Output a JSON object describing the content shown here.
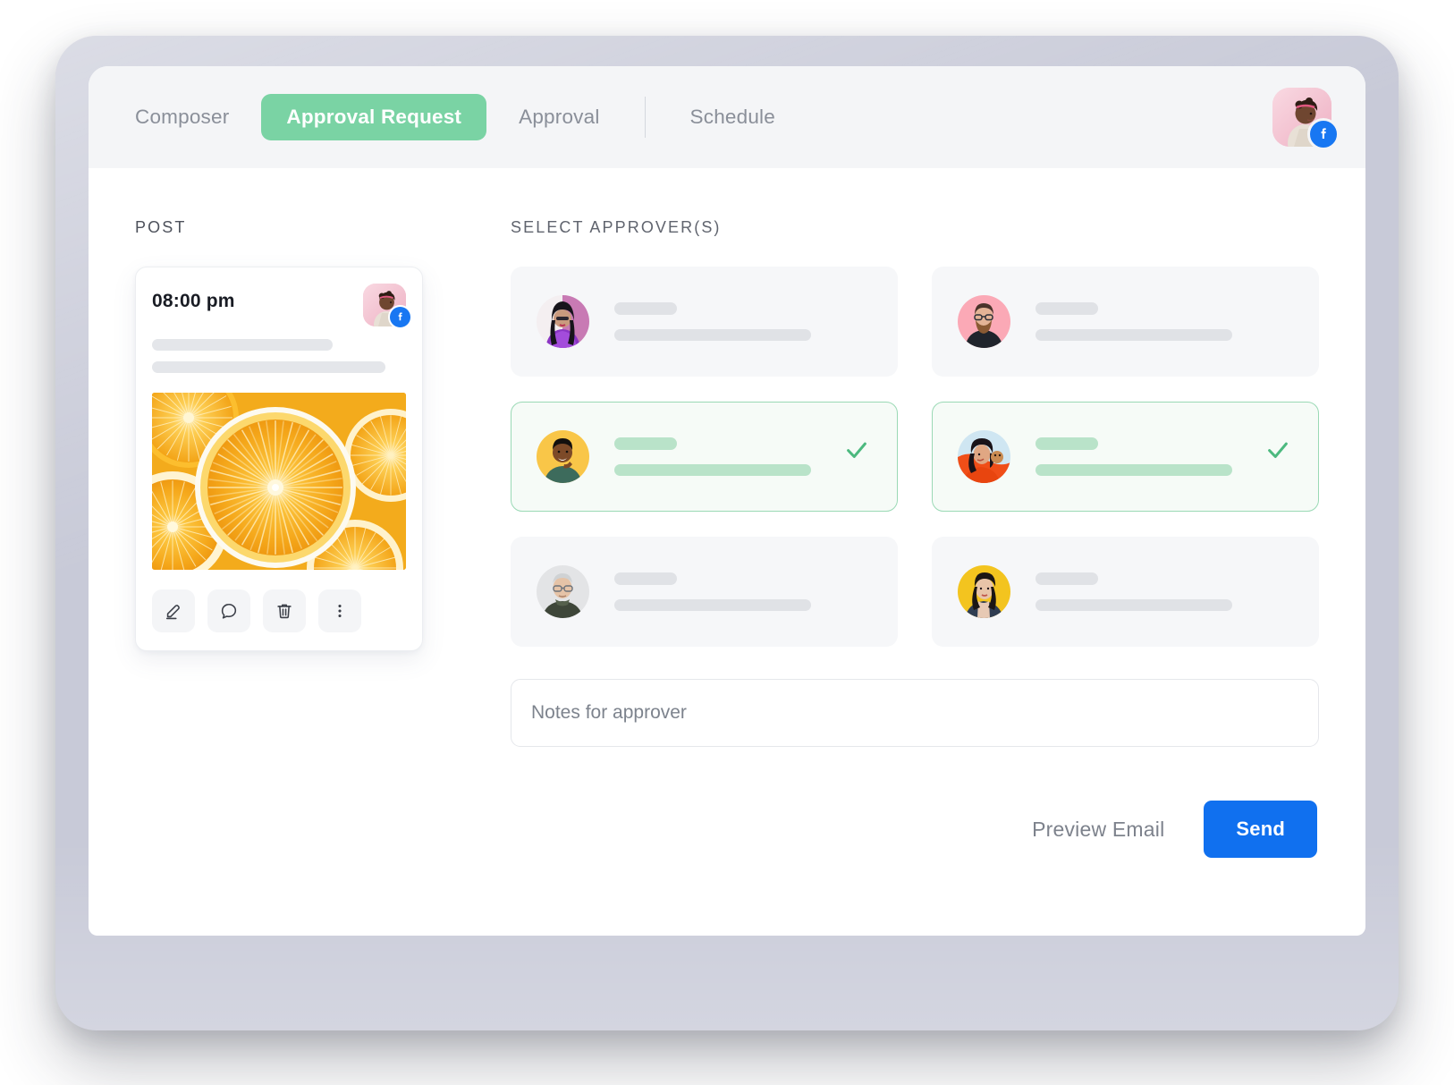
{
  "header": {
    "tabs": [
      {
        "label": "Composer",
        "active": false
      },
      {
        "label": "Approval Request",
        "active": true
      },
      {
        "label": "Approval",
        "active": false
      },
      {
        "label": "Schedule",
        "active": false
      }
    ],
    "account_avatar": "woman-portrait-avatar",
    "account_network_badge": "facebook-icon"
  },
  "post": {
    "section_label": "POST",
    "time": "08:00 pm",
    "avatar": "woman-portrait-avatar",
    "network_badge": "facebook-icon",
    "media": "orange-slices-photo",
    "actions": [
      {
        "name": "edit-post-button",
        "icon": "pencil-icon"
      },
      {
        "name": "comment-post-button",
        "icon": "speech-bubble-icon"
      },
      {
        "name": "delete-post-button",
        "icon": "trash-icon"
      },
      {
        "name": "more-options-button",
        "icon": "kebab-menu-icon"
      }
    ]
  },
  "approvers": {
    "section_label": "SELECT APPROVER(S)",
    "items": [
      {
        "name": "approver-1",
        "avatar": "woman-purple-jacket-avatar",
        "selected": false
      },
      {
        "name": "approver-2",
        "avatar": "bearded-man-pink-bg-avatar",
        "selected": false
      },
      {
        "name": "approver-3",
        "avatar": "smiling-man-yellow-bg-avatar",
        "selected": true
      },
      {
        "name": "approver-4",
        "avatar": "woman-orange-dress-avatar",
        "selected": true
      },
      {
        "name": "approver-5",
        "avatar": "older-man-grey-bg-avatar",
        "selected": false
      },
      {
        "name": "approver-6",
        "avatar": "woman-yellow-bg-avatar",
        "selected": false
      }
    ],
    "check_icon": "check-icon"
  },
  "notes": {
    "value": "",
    "placeholder": "Notes for approver"
  },
  "footer": {
    "preview_label": "Preview Email",
    "send_label": "Send"
  },
  "colors": {
    "accent_green": "#7ad3a4",
    "selected_border": "#9ad9b5",
    "selected_bg": "#f6fbf7",
    "send_blue": "#1070ef",
    "facebook_blue": "#1877f2",
    "bezel": "#c8cad8",
    "header_bg": "#f4f5f7",
    "card_bg": "#f6f7f9",
    "skeleton": "#e0e2e6",
    "skeleton_green": "#b9e3c9"
  }
}
